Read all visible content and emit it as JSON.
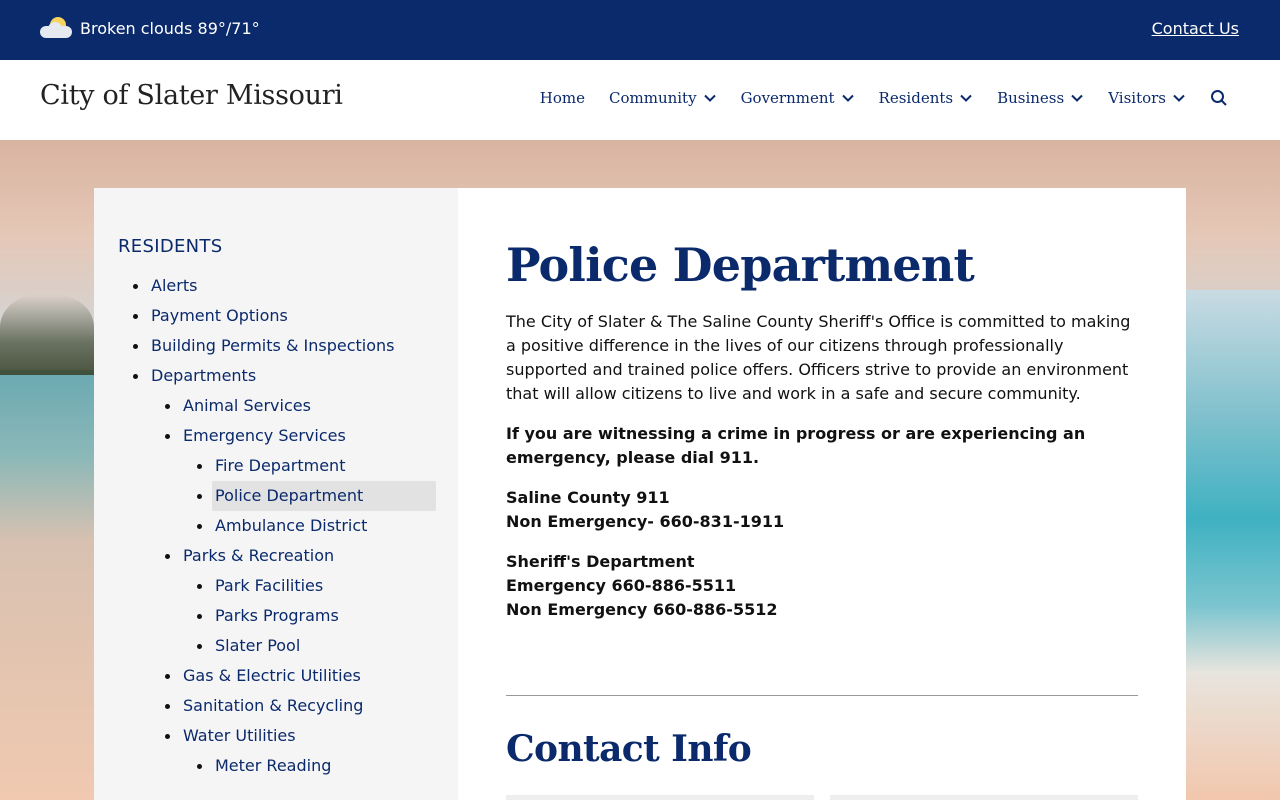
{
  "topbar": {
    "weather_text": "Broken clouds 89°/71°",
    "weather_icon": "partly-cloudy-icon",
    "contact_link": "Contact Us"
  },
  "header": {
    "site_title": "City of Slater Missouri",
    "nav": [
      {
        "label": "Home",
        "has_menu": false
      },
      {
        "label": "Community",
        "has_menu": true
      },
      {
        "label": "Government",
        "has_menu": true
      },
      {
        "label": "Residents",
        "has_menu": true
      },
      {
        "label": "Business",
        "has_menu": true
      },
      {
        "label": "Visitors",
        "has_menu": true
      }
    ],
    "search_icon": "search-icon"
  },
  "sidebar": {
    "heading": "RESIDENTS",
    "items": [
      {
        "label": "Alerts",
        "level": 1
      },
      {
        "label": "Payment Options",
        "level": 1
      },
      {
        "label": "Building Permits & Inspections",
        "level": 1
      },
      {
        "label": "Departments",
        "level": 1
      },
      {
        "label": "Animal Services",
        "level": 2
      },
      {
        "label": "Emergency Services",
        "level": 2
      },
      {
        "label": "Fire Department",
        "level": 3
      },
      {
        "label": "Police Department",
        "level": 3,
        "active": true
      },
      {
        "label": "Ambulance District",
        "level": 3
      },
      {
        "label": "Parks & Recreation",
        "level": 2
      },
      {
        "label": "Park Facilities",
        "level": 3
      },
      {
        "label": "Parks Programs",
        "level": 3
      },
      {
        "label": "Slater Pool",
        "level": 3
      },
      {
        "label": "Gas & Electric Utilities",
        "level": 2
      },
      {
        "label": "Sanitation & Recycling",
        "level": 2
      },
      {
        "label": "Water Utilities",
        "level": 2
      },
      {
        "label": "Meter Reading",
        "level": 3
      }
    ]
  },
  "main": {
    "title": "Police Department",
    "intro": "The City of Slater & The Saline County Sheriff's Office is committed to making a positive difference in the lives of our citizens through professionally supported and trained police offers. Officers strive to provide an environment that will allow citizens to live and work in a safe and secure community.",
    "alert": "If you are witnessing a crime in progress or are experiencing an emergency, please dial 911.",
    "saline_heading": "Saline County 911",
    "saline_non_emergency": "Non Emergency- 660-831-1911",
    "sheriff_heading": "Sheriff's Department",
    "sheriff_emergency": "Emergency 660-886-5511",
    "sheriff_non_emergency": "Non Emergency 660-886-5512",
    "contact_title": "Contact Info"
  },
  "colors": {
    "brand_navy": "#0b2a6b",
    "sidebar_bg": "#f5f5f5",
    "active_bg": "#e2e2e2"
  }
}
